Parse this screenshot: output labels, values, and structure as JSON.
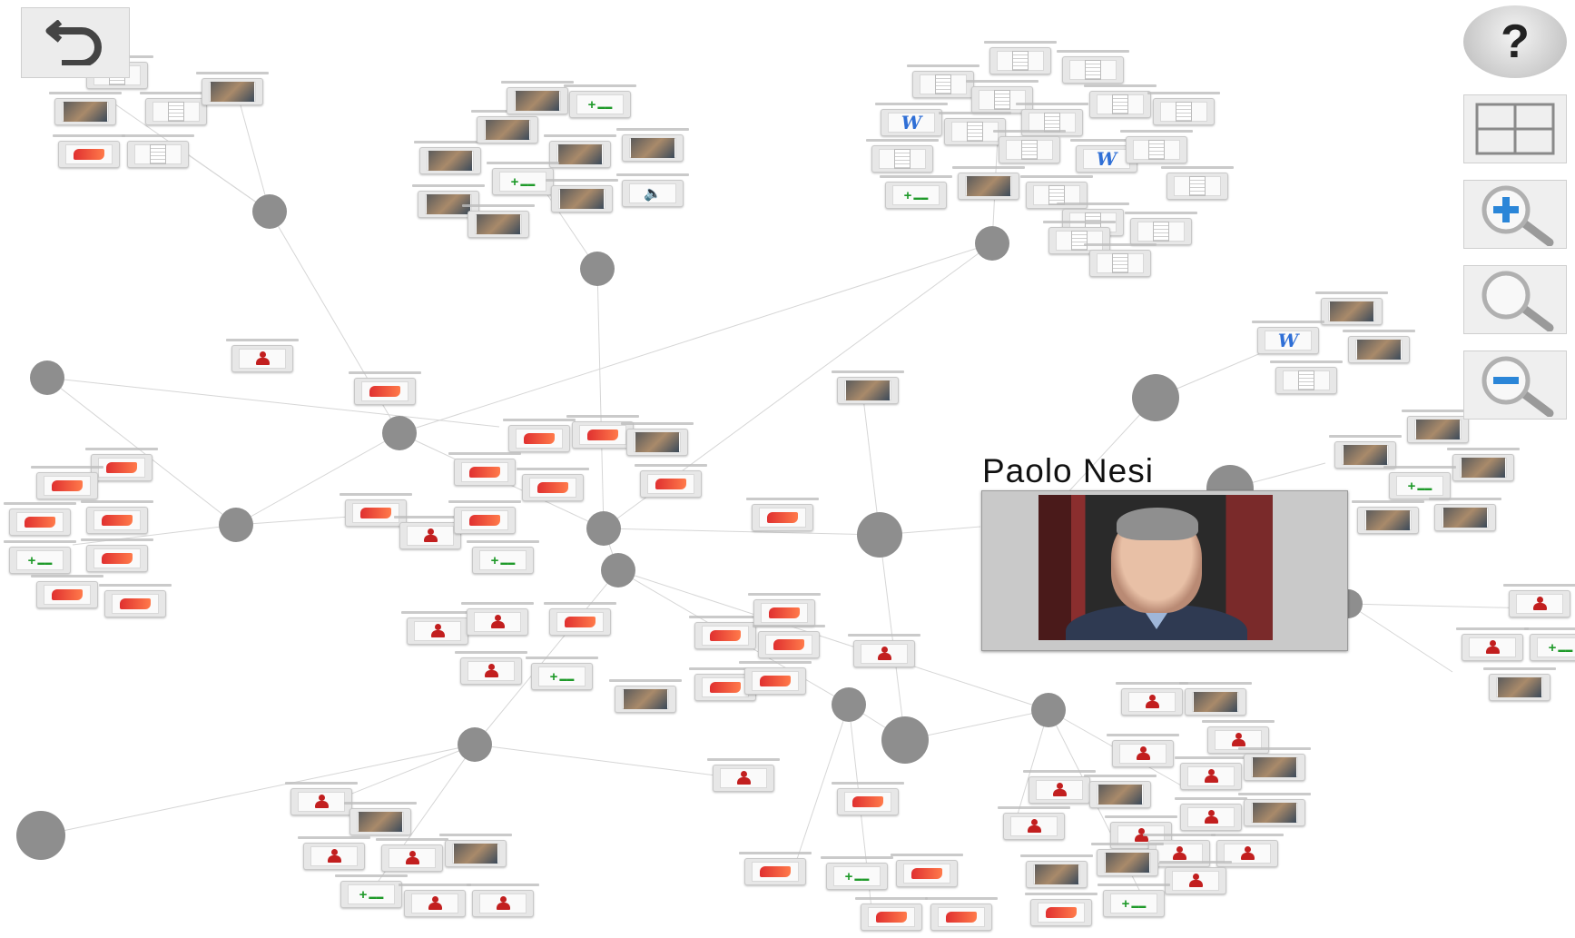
{
  "toolbar": {
    "help_label": "?",
    "back_icon": "undo-arrow-icon",
    "grid_icon": "grid-layout-icon",
    "zoom_in_icon": "zoom-in-icon",
    "zoom_reset_icon": "magnifier-icon",
    "zoom_out_icon": "zoom-out-icon"
  },
  "popup": {
    "name": "Paolo Nesi"
  },
  "colors": {
    "hub_node": "#8e8e8e",
    "edge": "#d6d6d6",
    "accent_red": "#c21f1f",
    "accent_green": "#1f9a2a",
    "word_blue": "#2f6fd6"
  }
}
